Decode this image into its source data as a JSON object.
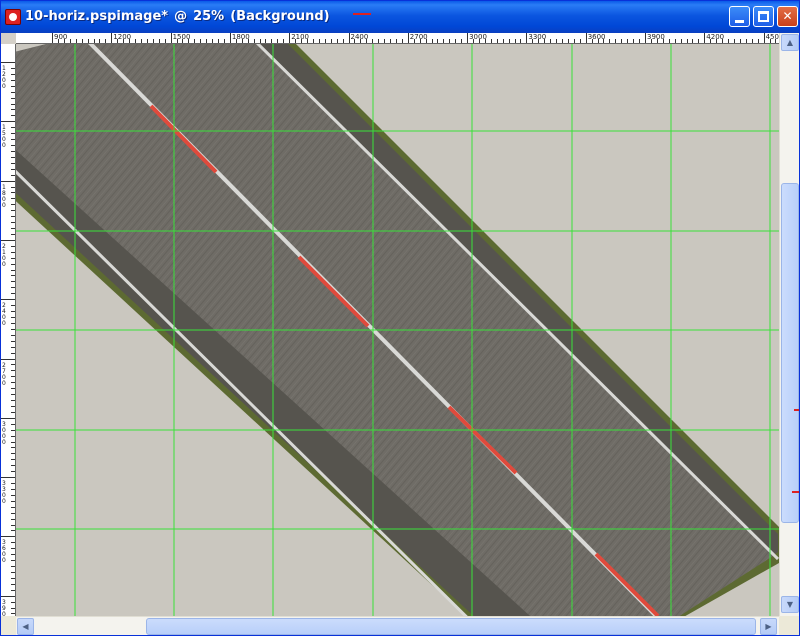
{
  "window": {
    "title_parts": [
      "10-horiz.pspimage*",
      "@",
      "25%",
      "(Background)"
    ],
    "buttons": {
      "minimize": "minimize",
      "maximize": "maximize",
      "close": "✕"
    }
  },
  "ruler": {
    "horizontal_labels": [
      "900",
      "1200",
      "1500",
      "1800",
      "2100",
      "2400",
      "2700",
      "3000",
      "3300",
      "3600",
      "3900",
      "4200",
      "4500"
    ],
    "vertical_labels": [
      "1200",
      "1500",
      "1800",
      "2100",
      "2400",
      "2700",
      "3000",
      "3300",
      "3600",
      "3900"
    ]
  },
  "canvas": {
    "background_color": "#cac7bf",
    "asphalt_color": "#6f6c66",
    "shoulder_color": "#56544e",
    "grass_color": "#5d6a32",
    "lane_line_color": "#d9d9d6",
    "center_red_color": "#e04a3c",
    "guide_color": "#39e239"
  },
  "scrollbars": {
    "up_arrow": "▲",
    "down_arrow": "▼",
    "left_arrow": "◀",
    "right_arrow": "▶"
  }
}
